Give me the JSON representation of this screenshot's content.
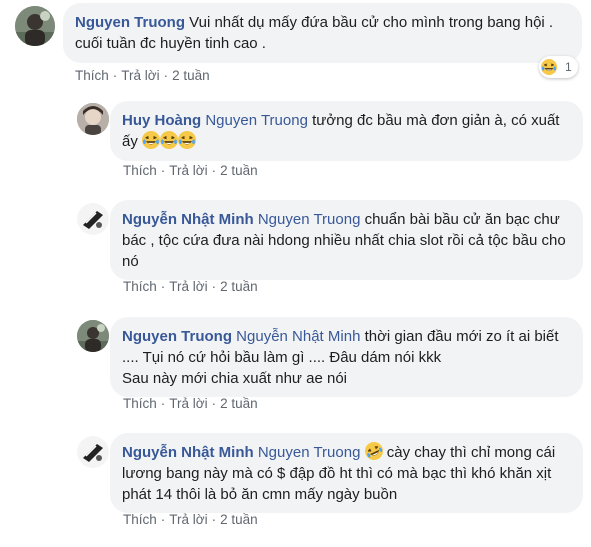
{
  "comments": [
    {
      "author": "Nguyen Truong",
      "mention": "",
      "text": "Vui nhất dụ mấy đứa bầu cử cho mình trong bang hội . cuối tuần đc huyền tinh cao .",
      "like": "Thích",
      "reply": "Trả lời",
      "time": "2 tuần",
      "reaction_count": "1"
    },
    {
      "author": "Huy Hoàng",
      "mention": "Nguyen Truong",
      "text": "tưởng đc bầu mà đơn giản à, có xuất ấy",
      "like": "Thích",
      "reply": "Trả lời",
      "time": "2 tuần"
    },
    {
      "author": "Nguyễn Nhật Minh",
      "mention": "Nguyen Truong",
      "text": "chuẩn bài bầu cử ăn bạc chư bác , tộc cứa đưa nài hdong nhiều nhất chia slot rồi cả tộc bầu cho nó",
      "like": "Thích",
      "reply": "Trả lời",
      "time": "2 tuần"
    },
    {
      "author": "Nguyen Truong",
      "mention": "Nguyễn Nhật Minh",
      "text": "thời gian đầu mới zo ít ai biết .... Tụi nó cứ hỏi bầu làm gì .... Đâu dám nói kkk",
      "text2": "Sau này mới chia xuất như ae nói",
      "like": "Thích",
      "reply": "Trả lời",
      "time": "2 tuần"
    },
    {
      "author": "Nguyễn Nhật Minh",
      "mention": "Nguyen Truong",
      "text": "cày chay thì chỉ mong cái lương bang này mà có $ đập đồ ht thì có mà bạc thì khó khăn xịt phát 14 thôi là bỏ ăn cmn mấy ngày buồn",
      "like": "Thích",
      "reply": "Trả lời",
      "time": "2 tuần"
    }
  ],
  "colors": {
    "link": "#385898",
    "bubble": "#f2f3f5",
    "meta": "#606770"
  },
  "icons": [
    "laughing-emoji",
    "rofl-emoji",
    "avatar"
  ]
}
